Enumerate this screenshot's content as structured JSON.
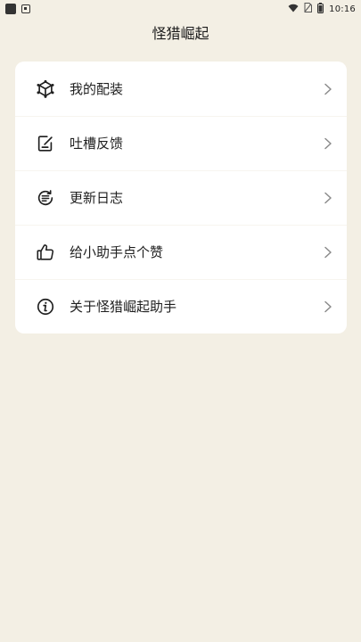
{
  "status_bar": {
    "time": "10:16",
    "icons": [
      "app-notification-icon",
      "image-notification-icon",
      "wifi-icon",
      "no-sim-icon",
      "battery-icon"
    ]
  },
  "header": {
    "title": "怪猎崛起"
  },
  "menu": {
    "items": [
      {
        "label": "我的配装",
        "icon": "gear-cube-icon"
      },
      {
        "label": "吐槽反馈",
        "icon": "feedback-edit-icon"
      },
      {
        "label": "更新日志",
        "icon": "update-log-icon"
      },
      {
        "label": "给小助手点个赞",
        "icon": "thumbs-up-icon"
      },
      {
        "label": "关于怪猎崛起助手",
        "icon": "info-icon"
      }
    ]
  },
  "colors": {
    "background": "#f3efe4",
    "card": "#ffffff",
    "text": "#1f1f1f",
    "chevron": "#8a8a8a"
  }
}
